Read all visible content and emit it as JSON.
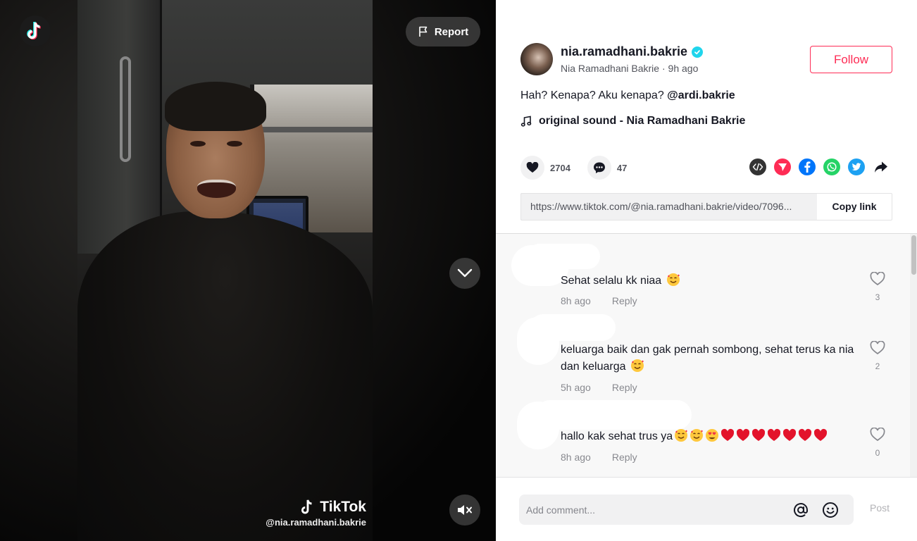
{
  "video": {
    "report_label": "Report",
    "watermark_brand": "TikTok",
    "watermark_handle": "@nia.ramadhani.bakrie"
  },
  "author": {
    "username": "nia.ramadhani.bakrie",
    "display_name": "Nia Ramadhani Bakrie",
    "time_ago": "9h ago",
    "follow_label": "Follow"
  },
  "post": {
    "caption_text": "Hah? Kenapa? Aku kenapa? ",
    "caption_mention": "@ardi.bakrie",
    "sound": "original sound - Nia Ramadhani Bakrie",
    "likes": "2704",
    "comments": "47",
    "link": "https://www.tiktok.com/@nia.ramadhani.bakrie/video/7096...",
    "copy_label": "Copy link"
  },
  "share_icons": [
    "embed-icon",
    "send-to-friends-icon",
    "facebook-icon",
    "whatsapp-icon",
    "twitter-icon",
    "share-arrow-icon"
  ],
  "comments": [
    {
      "text": "Sehat selalu kk niaa",
      "emojis": [
        "smiling-hearts"
      ],
      "time": "8h ago",
      "reply": "Reply",
      "likes": "3"
    },
    {
      "text": "keluarga baik dan gak pernah sombong, sehat terus ka nia dan keluarga",
      "emojis": [
        "smiling-hearts"
      ],
      "time": "5h ago",
      "reply": "Reply",
      "likes": "2"
    },
    {
      "text": "hallo kak sehat trus ya",
      "emojis": [
        "smiling-hearts",
        "smiling-hearts",
        "heart-eyes",
        "red-heart",
        "red-heart",
        "red-heart",
        "red-heart",
        "red-heart",
        "red-heart",
        "red-heart"
      ],
      "time": "8h ago",
      "reply": "Reply",
      "likes": "0"
    }
  ],
  "comment_input": {
    "placeholder": "Add comment...",
    "post_label": "Post"
  },
  "colors": {
    "brand": "#fe2c55",
    "verified": "#20d5ec",
    "text": "#161823"
  }
}
